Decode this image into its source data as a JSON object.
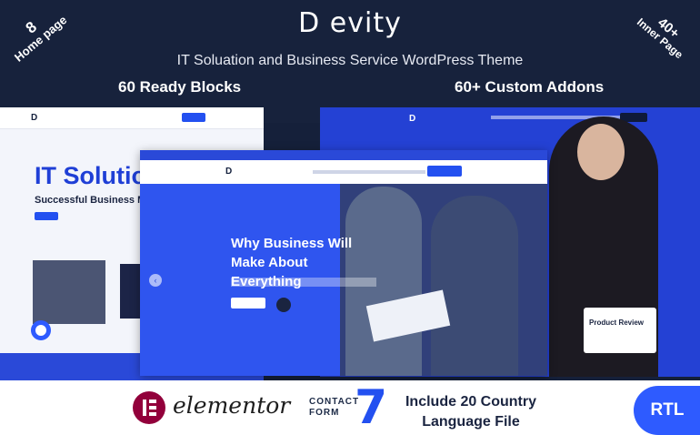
{
  "header": {
    "brand": "D evity",
    "tagline": "IT Soluation and Business Service WordPress Theme",
    "features": [
      "60 Ready Blocks",
      "60+ Custom Addons"
    ],
    "badge_left": {
      "number": "8",
      "label": "Home page"
    },
    "badge_right": {
      "number": "40+",
      "label": "Inner Page"
    }
  },
  "previews": {
    "left": {
      "hero_title": "IT Solutio",
      "hero_subtitle": "Successful Business Men"
    },
    "center": {
      "hero_title": "Why Business Will Make About Everything"
    },
    "right": {
      "card_label": "Product Review"
    }
  },
  "footer": {
    "elementor": "elementor",
    "contact_form": "CONTACT FORM",
    "contact_form_number": "7",
    "language_line1": "Include 20 Country",
    "language_line2": "Language File",
    "rtl": "RTL"
  },
  "colors": {
    "accent": "#2e5bff",
    "dark": "#17223c",
    "elementor": "#92003b"
  }
}
